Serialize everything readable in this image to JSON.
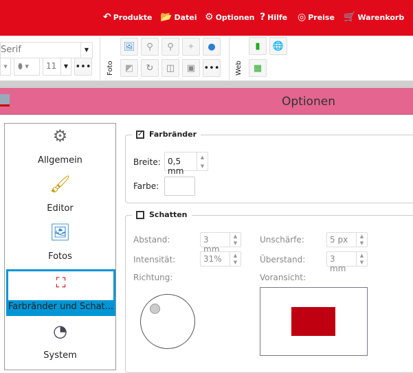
{
  "menu": [
    {
      "label": "Produkte",
      "icon": "arrow-icon"
    },
    {
      "label": "Datei",
      "icon": "folder-icon"
    },
    {
      "label": "Optionen",
      "icon": "gear-icon"
    },
    {
      "label": "Hilfe",
      "icon": "help-icon"
    },
    {
      "label": "Preise",
      "icon": "coins-icon"
    },
    {
      "label": "Warenkorb",
      "icon": "cart-icon"
    }
  ],
  "toolbar": {
    "font": "Serif",
    "font_size": "11",
    "more": "•••",
    "foto_label": "Foto",
    "web_label": "Web"
  },
  "window": {
    "title": "Optionen"
  },
  "sidebar": [
    {
      "label": "Allgemein"
    },
    {
      "label": "Editor"
    },
    {
      "label": "Fotos"
    },
    {
      "label": "Farbränder und Schat..."
    },
    {
      "label": "System"
    }
  ],
  "borders": {
    "title": "Farbränder",
    "checked": true,
    "width_label": "Breite:",
    "width_value": "0,5 mm",
    "color_label": "Farbe:"
  },
  "shadow": {
    "title": "Schatten",
    "checked": false,
    "distance_label": "Abstand:",
    "distance_value": "3 mm",
    "blur_label": "Unschärfe:",
    "blur_value": "5 px",
    "intensity_label": "Intensität:",
    "intensity_value": "31%",
    "overhang_label": "Überstand:",
    "overhang_value": "3 mm",
    "direction_label": "Richtung:",
    "preview_label": "Voransicht:",
    "preview_color": "#bf0010"
  }
}
